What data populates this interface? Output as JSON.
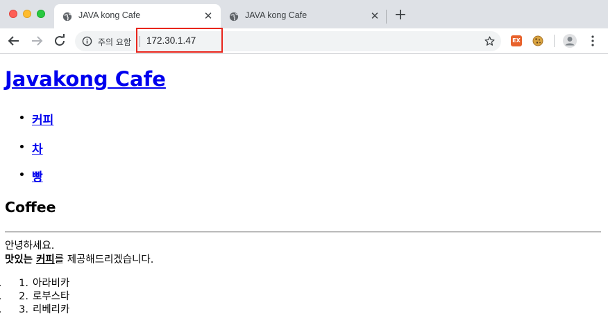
{
  "browser": {
    "tabs": [
      {
        "title": "JAVA kong Cafe",
        "active": true
      },
      {
        "title": "JAVA kong Cafe",
        "active": false
      }
    ],
    "tab_close_glyph": "✕",
    "new_tab_glyph": "+",
    "security_label": "주의 요함",
    "url": "172.30.1.47",
    "extensions": [
      {
        "icon": "ex-extension-icon",
        "label": "EX",
        "color": "#e8622c"
      },
      {
        "icon": "cookie-extension-icon"
      }
    ],
    "highlight_color": "#e8251c"
  },
  "page": {
    "site_title": "Javakong Cafe",
    "nav": [
      {
        "label": "커피"
      },
      {
        "label": "차"
      },
      {
        "label": "빵"
      }
    ],
    "section_heading": "Coffee",
    "greeting": "안녕하세요.",
    "intro_bold": "맛있는 ",
    "intro_link": "커피",
    "intro_rest": "를 제공해드리겠습니다.",
    "menu_items": [
      "아라비카",
      "로부스타",
      "리베리카"
    ],
    "menu_numbers": [
      "1.",
      "2.",
      "3."
    ],
    "link_color": "#0000ee"
  }
}
